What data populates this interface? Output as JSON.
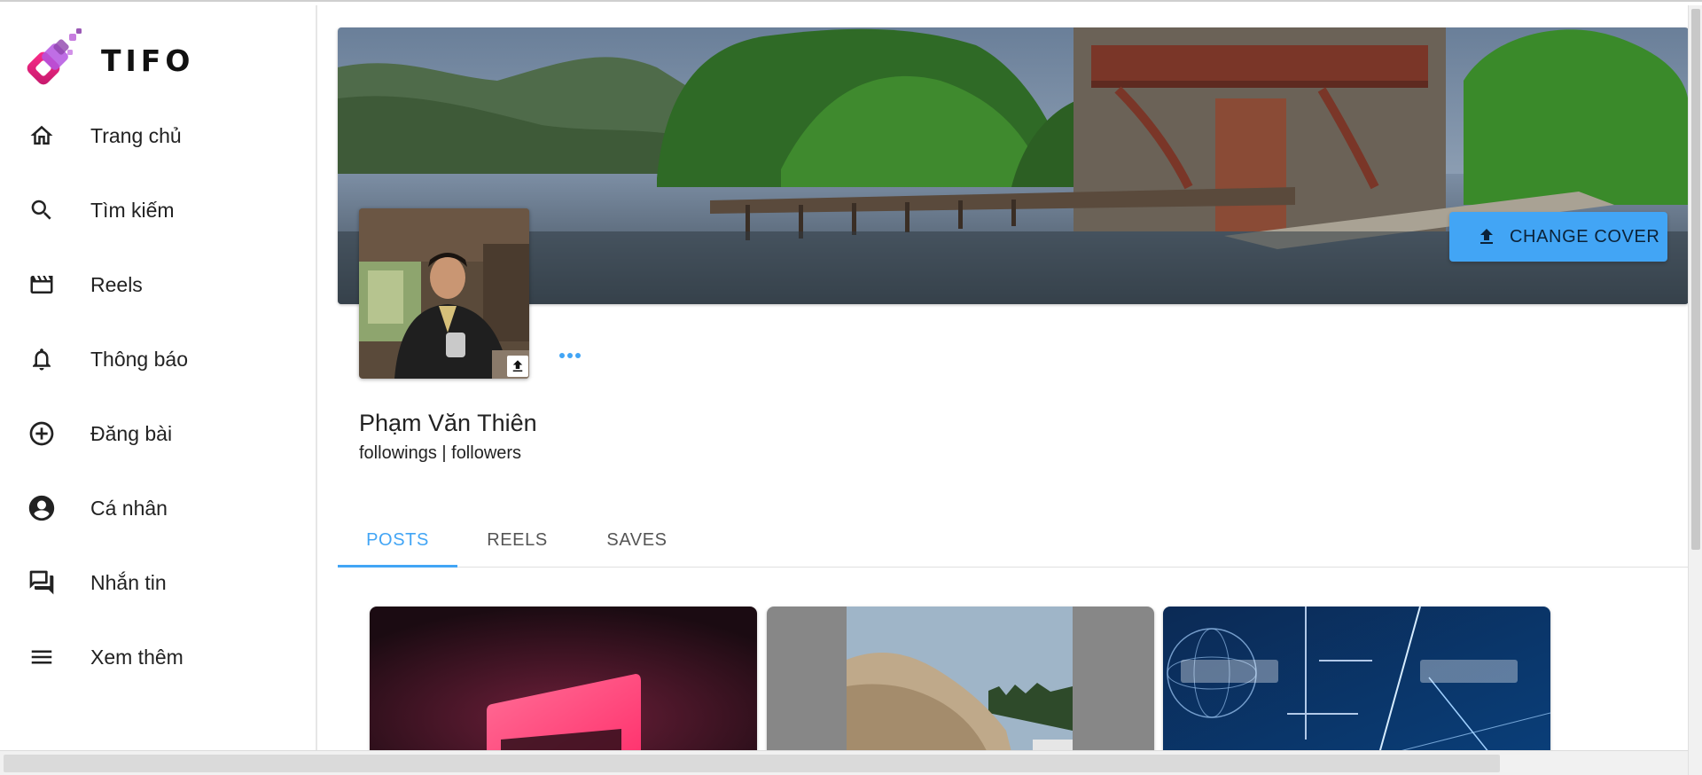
{
  "app": {
    "logo_text": "TIFO"
  },
  "sidebar": {
    "items": [
      {
        "label": "Trang chủ",
        "icon": "home-icon"
      },
      {
        "label": "Tìm kiếm",
        "icon": "search-icon"
      },
      {
        "label": "Reels",
        "icon": "clapperboard-icon"
      },
      {
        "label": "Thông báo",
        "icon": "bell-icon"
      },
      {
        "label": "Đăng bài",
        "icon": "add-circle-icon"
      },
      {
        "label": "Cá nhân",
        "icon": "account-circle-icon"
      },
      {
        "label": "Nhắn tin",
        "icon": "chat-icon"
      },
      {
        "label": "Xem thêm",
        "icon": "menu-icon"
      }
    ]
  },
  "profile": {
    "change_cover_label": "CHANGE COVER",
    "name": "Phạm Văn Thiên",
    "follow_text": "followings | followers"
  },
  "tabs": [
    {
      "label": "POSTS",
      "active": true
    },
    {
      "label": "REELS",
      "active": false
    },
    {
      "label": "SAVES",
      "active": false
    }
  ],
  "posts": [
    {
      "image": "pink-neon-square"
    },
    {
      "image": "vintage-car-trees"
    },
    {
      "image": "istock-digital-globe"
    }
  ],
  "colors": {
    "accent": "#42a5f5",
    "logo_pink": "#e91e8c",
    "logo_purple": "#8e44ad"
  }
}
